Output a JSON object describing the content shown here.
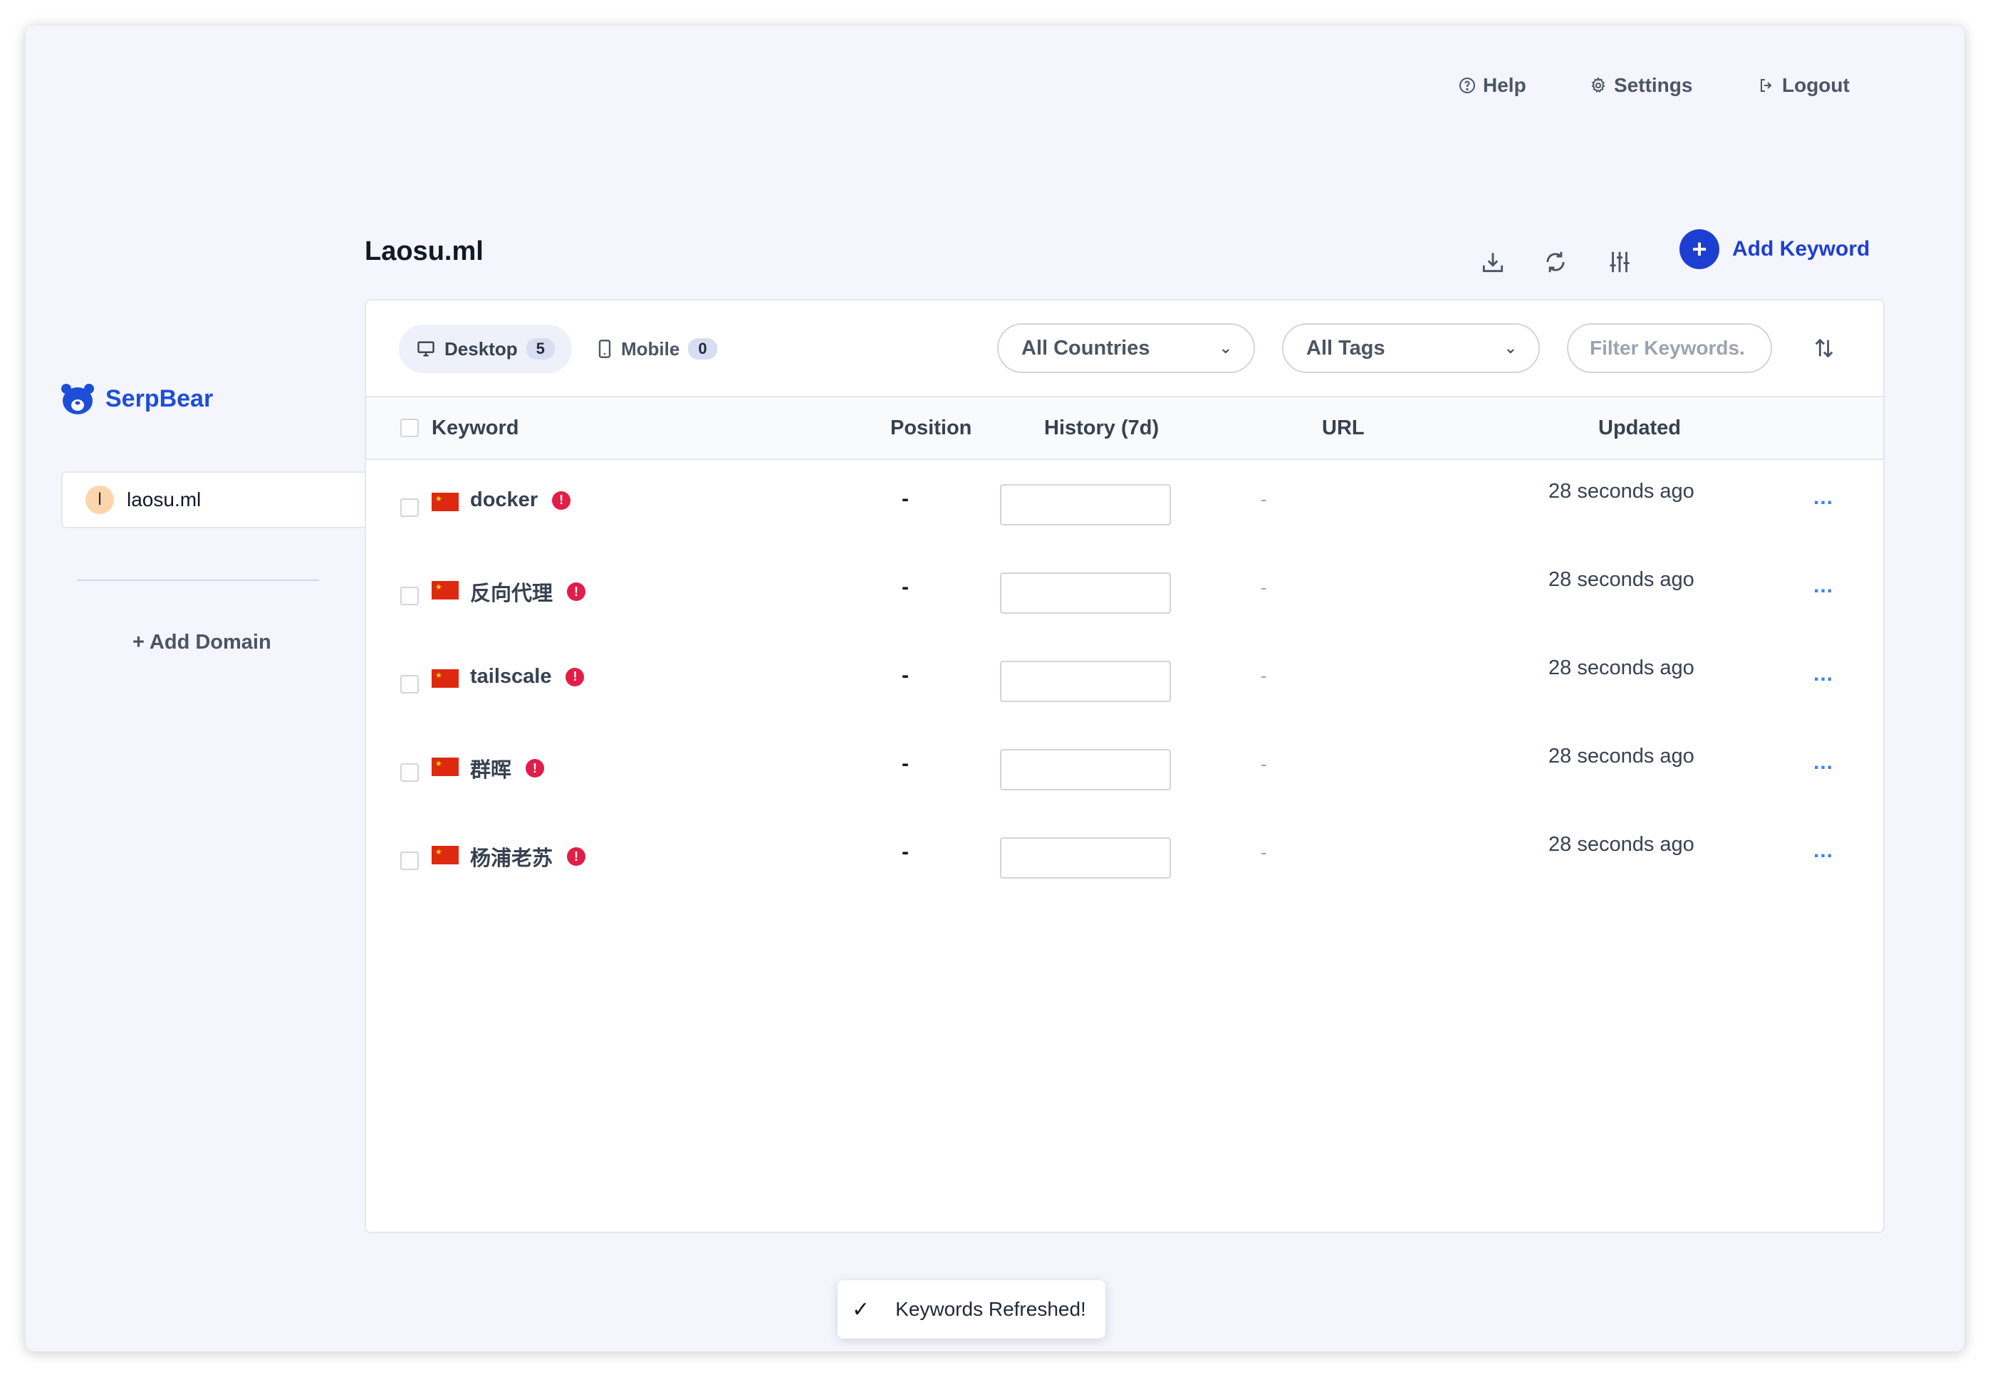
{
  "topnav": {
    "help_label": "Help",
    "settings_label": "Settings",
    "logout_label": "Logout"
  },
  "brand": {
    "name": "SerpBear",
    "color": "#1d4ed8"
  },
  "sidebar": {
    "domains": [
      {
        "initial": "l",
        "name": "laosu.ml"
      }
    ],
    "add_domain_label": "+ Add Domain"
  },
  "header": {
    "title": "Laosu.ml",
    "add_keyword_label": "Add Keyword",
    "action_icons": [
      "download-icon",
      "refresh-icon",
      "sliders-icon"
    ]
  },
  "toolbar": {
    "tabs": [
      {
        "label": "Desktop",
        "count": "5"
      },
      {
        "label": "Mobile",
        "count": "0"
      }
    ],
    "countries_select": "All Countries",
    "tags_select": "All Tags",
    "filter_placeholder": "Filter Keywords."
  },
  "table": {
    "columns": [
      "Keyword",
      "Position",
      "History (7d)",
      "URL",
      "Updated"
    ],
    "rows": [
      {
        "country": "CN",
        "keyword": "docker",
        "position": "-",
        "url": "-",
        "updated": "28 seconds ago",
        "more": "..."
      },
      {
        "country": "CN",
        "keyword": "反向代理",
        "position": "-",
        "url": "-",
        "updated": "28 seconds ago",
        "more": "..."
      },
      {
        "country": "CN",
        "keyword": "tailscale",
        "position": "-",
        "url": "-",
        "updated": "28 seconds ago",
        "more": "..."
      },
      {
        "country": "CN",
        "keyword": "群晖",
        "position": "-",
        "url": "-",
        "updated": "28 seconds ago",
        "more": "..."
      },
      {
        "country": "CN",
        "keyword": "杨浦老苏",
        "position": "-",
        "url": "-",
        "updated": "28 seconds ago",
        "more": "..."
      }
    ]
  },
  "toast": {
    "icon": "checkmark-icon",
    "message": "Keywords Refreshed!"
  },
  "colors": {
    "accent": "#1d3fd1",
    "error": "#e11d48",
    "background": "#f4f5fd"
  }
}
